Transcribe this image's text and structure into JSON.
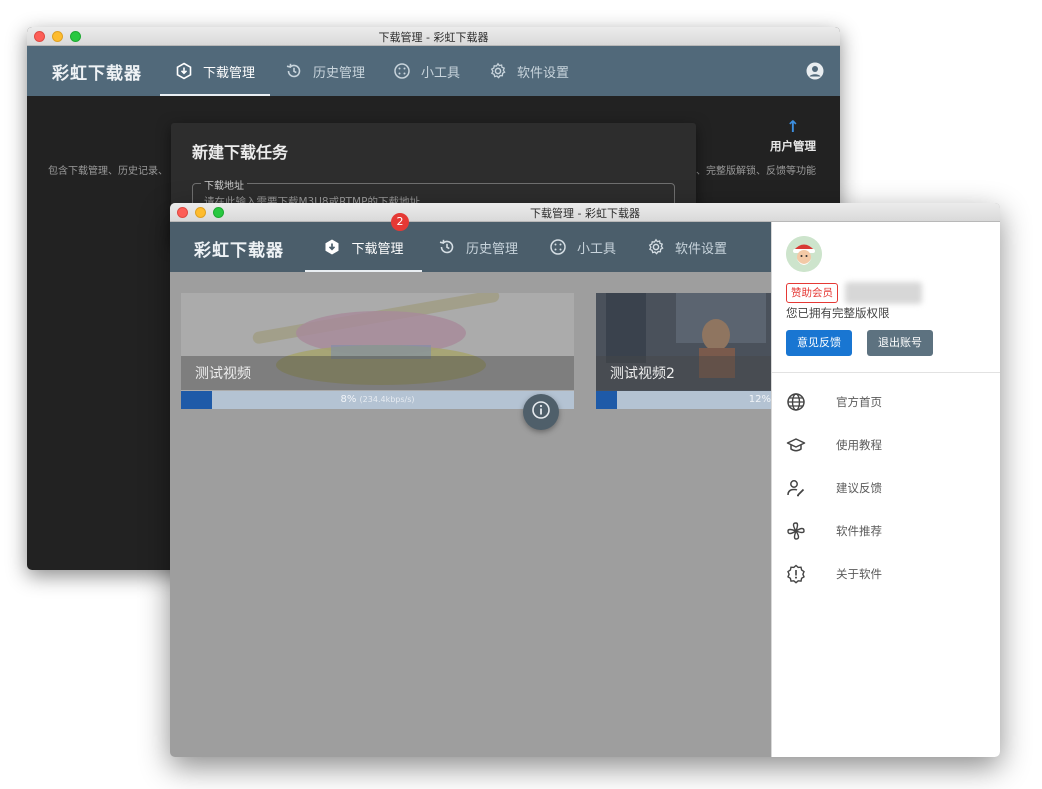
{
  "back_window": {
    "title": "下载管理 - 彩虹下载器",
    "brand": "彩虹下载器",
    "tabs": [
      {
        "label": "下载管理",
        "icon": "download-icon"
      },
      {
        "label": "历史管理",
        "icon": "history-icon"
      },
      {
        "label": "小工具",
        "icon": "tools-icon"
      },
      {
        "label": "软件设置",
        "icon": "gear-icon"
      }
    ],
    "left_text": "包含下载管理、历史记录、",
    "right_text": "、完整版解锁、反馈等功能",
    "user_mgmt_label": "用户管理",
    "dialog": {
      "title": "新建下载任务",
      "field_label": "下载地址",
      "field_placeholder": "请在此输入需要下载M3U8或RTMP的下载地址"
    }
  },
  "front_window": {
    "title": "下载管理 - 彩虹下载器",
    "brand": "彩虹下载器",
    "tabs": [
      {
        "label": "下载管理",
        "icon": "download-icon",
        "badge": "2"
      },
      {
        "label": "历史管理",
        "icon": "history-icon"
      },
      {
        "label": "小工具",
        "icon": "tools-icon"
      },
      {
        "label": "软件设置",
        "icon": "gear-icon"
      }
    ],
    "cards": [
      {
        "title": "测试视频",
        "progress": 8,
        "progress_text": "8%",
        "speed": "(234.4kbps/s)"
      },
      {
        "title": "测试视频2",
        "progress": 12,
        "progress_text": "12%"
      }
    ],
    "drawer": {
      "vip_tag": "赞助会员",
      "permission_text": "您已拥有完整版权限",
      "feedback_button": "意见反馈",
      "logout_button": "退出账号",
      "menu": [
        {
          "label": "官方首页",
          "icon": "globe-icon"
        },
        {
          "label": "使用教程",
          "icon": "graduation-cap-icon"
        },
        {
          "label": "建议反馈",
          "icon": "user-edit-icon"
        },
        {
          "label": "软件推荐",
          "icon": "pinwheel-icon"
        },
        {
          "label": "关于软件",
          "icon": "alert-badge-icon"
        }
      ]
    }
  },
  "colors": {
    "appbar": "#51697a",
    "accent_blue": "#1976d2",
    "badge_red": "#e53935",
    "progress_fill": "#1e5aa8"
  }
}
